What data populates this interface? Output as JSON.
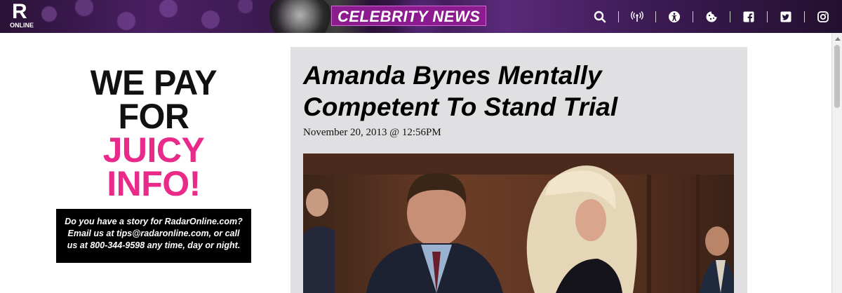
{
  "header": {
    "logo_letter": "R",
    "logo_sub": "ONLINE",
    "section": "CELEBRITY NEWS",
    "nav_icons": [
      "search-icon",
      "broadcast-icon",
      "accessibility-icon",
      "cookie-icon",
      "facebook-icon",
      "twitter-icon",
      "instagram-icon"
    ]
  },
  "promo": {
    "line1": "WE PAY FOR",
    "line2": "JUICY INFO!",
    "body": "Do you have a story for RadarOnline.com? Email us at tips@radaronline.com, or call us at 800-344-9598 any time, day or night."
  },
  "article": {
    "title": "Amanda Bynes Mentally Competent To Stand Trial",
    "date": "November 20, 2013 @ 12:56PM"
  },
  "colors": {
    "accent_pink": "#ea2a89",
    "section_purple": "#8b1b8f",
    "card_bg": "#e0e0e2"
  }
}
